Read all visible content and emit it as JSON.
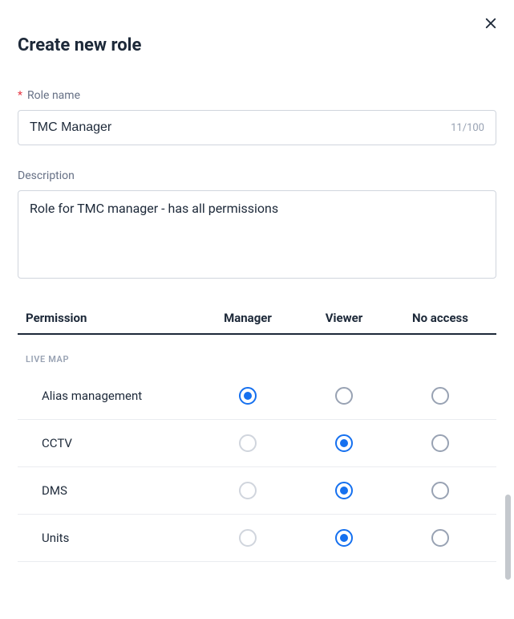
{
  "title": "Create new role",
  "roleName": {
    "label": "Role name",
    "required": true,
    "value": "TMC Manager",
    "charCount": "11/100"
  },
  "description": {
    "label": "Description",
    "value": "Role for TMC manager - has all permissions"
  },
  "permTable": {
    "headers": {
      "permission": "Permission",
      "manager": "Manager",
      "viewer": "Viewer",
      "noAccess": "No access"
    },
    "section": "LIVE MAP",
    "rows": [
      {
        "name": "Alias management",
        "selected": "manager",
        "managerDisabled": false
      },
      {
        "name": "CCTV",
        "selected": "viewer",
        "managerDisabled": true
      },
      {
        "name": "DMS",
        "selected": "viewer",
        "managerDisabled": true
      },
      {
        "name": "Units",
        "selected": "viewer",
        "managerDisabled": true
      }
    ]
  }
}
